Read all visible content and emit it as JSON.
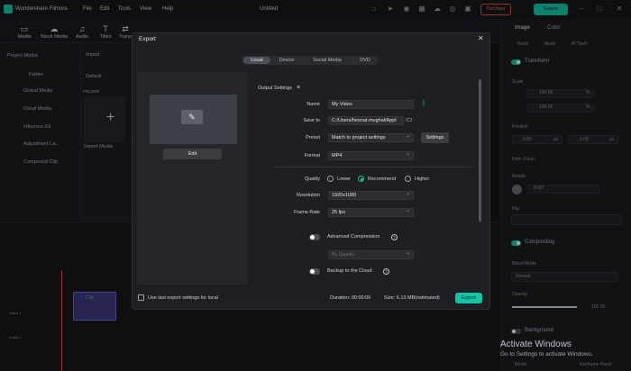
{
  "app": {
    "name": "Wondershare Filmora",
    "menu": [
      "File",
      "Edit",
      "Tools",
      "View",
      "Help"
    ],
    "document_title": "Untitled",
    "purchase_label": "Purchase",
    "export_label": "Export"
  },
  "toolbar": {
    "tools": [
      {
        "label": "Media",
        "icon": "media-icon"
      },
      {
        "label": "Stock Media",
        "icon": "cloud-icon"
      },
      {
        "label": "Audio",
        "icon": "music-icon"
      },
      {
        "label": "Titles",
        "icon": "text-icon"
      },
      {
        "label": "Trans",
        "icon": "transition-icon"
      }
    ]
  },
  "left_panel": {
    "items": [
      "Project Media",
      "Folder",
      "Global Media",
      "Cloud Media",
      "Influence Kit",
      "Adjustment La...",
      "Compound Clip"
    ],
    "import_label": "Import",
    "sort_label": "Default",
    "folder_header": "FOLDER",
    "import_media_label": "Import Media"
  },
  "right_panel": {
    "tabs": [
      "Image",
      "Color"
    ],
    "subtabs": [
      "Basic",
      "Mask",
      "AI Tools"
    ],
    "sections": {
      "transform": "Transform",
      "scale": "Scale",
      "position": "Position",
      "path_curve": "Path Curve",
      "rotate": "Rotate",
      "flip": "Flip",
      "compositing": "Compositing",
      "blend_mode": "Blend Mode",
      "opacity": "Opacity",
      "background": "Background"
    },
    "scale_x": "100.00",
    "scale_y": "100.00",
    "scale_unit": "%",
    "pos_x": "0.00",
    "pos_y": "0.00",
    "pos_unit": "px",
    "rotate_value": "0.00°",
    "blend_mode_value": "Normal",
    "opacity_value": "100.00",
    "reset_label": "Reset",
    "keyframe_label": "Keyframe Panel"
  },
  "timeline": {
    "clip_label": "Clip",
    "track_video": "Video 1",
    "track_audio": "Audio 1"
  },
  "export_dialog": {
    "title": "Export",
    "tabs": [
      "Local",
      "Device",
      "Social Media",
      "DVD"
    ],
    "active_tab": "Local",
    "edit_label": "Edit",
    "output_settings_label": "Output Settings",
    "fields": {
      "name_label": "Name",
      "name_value": "My Video",
      "save_to_label": "Save to",
      "save_to_value": "C:/Users/hesnat.mughal/Appl",
      "preset_label": "Preset",
      "preset_value": "Match to project settings",
      "settings_button": "Settings",
      "format_label": "Format",
      "format_value": "MP4",
      "quality_label": "Quality",
      "quality_options": [
        "Lower",
        "Recommend",
        "Higher"
      ],
      "quality_selected": "Recommend",
      "resolution_label": "Resolution",
      "resolution_value": "1920x1080",
      "frame_rate_label": "Frame Rate",
      "frame_rate_value": "25 fps",
      "advanced_compression_label": "Advanced Compression",
      "by_quality_value": "By Quality",
      "backup_label": "Backup to the Cloud"
    },
    "footer": {
      "use_last_label": "Use last export settings for local",
      "duration": "Duration: 00:00:06",
      "size": "Size: 6.13 MB(estimated)",
      "export_button": "Export"
    }
  },
  "watermark": {
    "line1": "Activate Windows",
    "line2": "Go to Settings to activate Windows."
  },
  "colors": {
    "accent": "#14c6a6",
    "purchase": "#e0734f"
  }
}
